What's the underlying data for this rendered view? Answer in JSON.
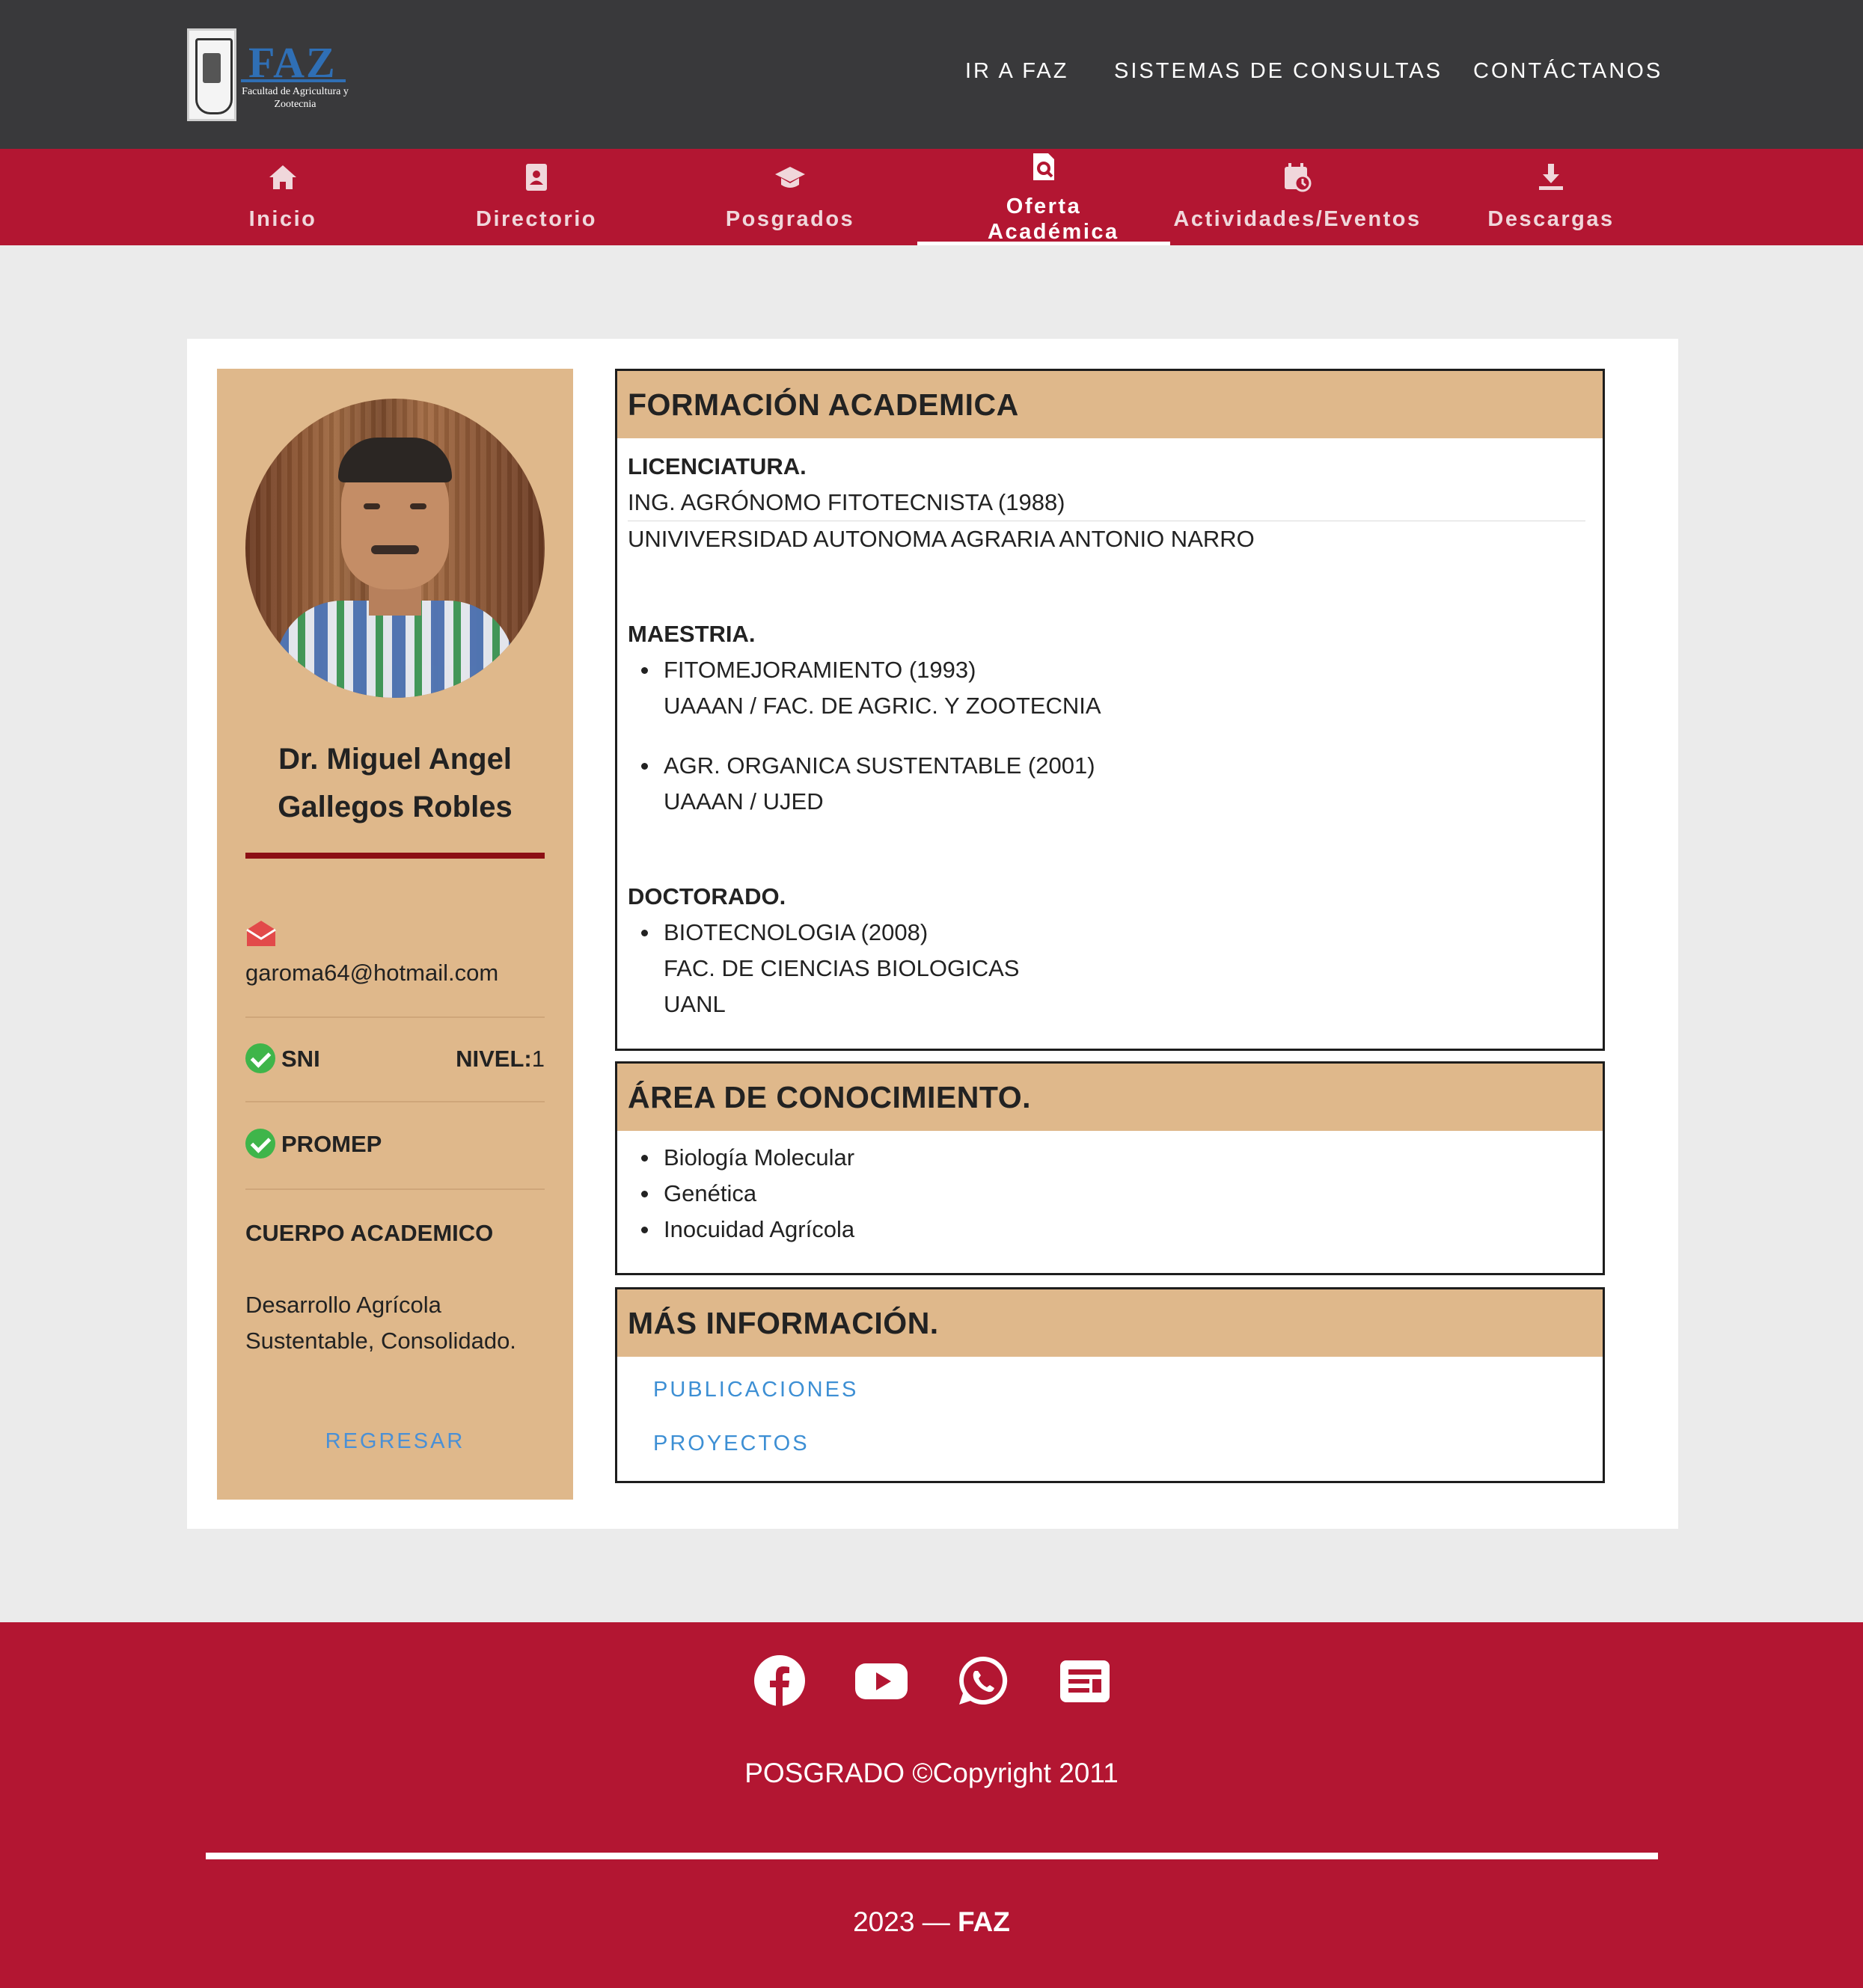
{
  "brand": {
    "logo_text": "FAZ",
    "logo_subtitle": "Facultad de Agricultura y Zootecnia"
  },
  "topnav": [
    {
      "label": "IR A FAZ"
    },
    {
      "label": "SISTEMAS DE CONSULTAS"
    },
    {
      "label": "CONTÁCTANOS"
    }
  ],
  "mainnav": [
    {
      "label": "Inicio",
      "icon": "home-icon"
    },
    {
      "label": "Directorio",
      "icon": "contact-book-icon"
    },
    {
      "label": "Posgrados",
      "icon": "graduation-cap-icon"
    },
    {
      "label": "Oferta Académica",
      "icon": "search-document-icon",
      "active": true
    },
    {
      "label": "Actividades/Eventos",
      "icon": "calendar-clock-icon"
    },
    {
      "label": "Descargas",
      "icon": "download-icon"
    }
  ],
  "profile": {
    "name": "Dr. Miguel Angel Gallegos Robles",
    "email": "garoma64@hotmail.com",
    "snni_label": "SNI",
    "nivel_label": "NIVEL:",
    "nivel_value": "1",
    "promep_label": "PROMEP",
    "cuerpo_title": "CUERPO ACADEMICO",
    "cuerpo_text": "Desarrollo Agrícola Sustentable, Consolidado.",
    "back_label": "REGRESAR"
  },
  "formacion": {
    "title": "FORMACIÓN ACADEMICA",
    "licenciatura": {
      "label": "LICENCIATURA.",
      "degree": "ING. AGRÓNOMO FITOTECNISTA (1988)",
      "school": "UNIVIVERSIDAD AUTONOMA AGRARIA ANTONIO NARRO"
    },
    "maestria": {
      "label": "MAESTRIA.",
      "items": [
        {
          "degree": "FITOMEJORAMIENTO (1993)",
          "school": "UAAAN / FAC. DE AGRIC. Y ZOOTECNIA"
        },
        {
          "degree": "AGR. ORGANICA SUSTENTABLE (2001)",
          "school": "UAAAN / UJED"
        }
      ]
    },
    "doctorado": {
      "label": "DOCTORADO.",
      "degree": "BIOTECNOLOGIA (2008)",
      "school1": "FAC. DE CIENCIAS BIOLOGICAS",
      "school2": "UANL"
    }
  },
  "area": {
    "title": "ÁREA DE CONOCIMIENTO.",
    "items": [
      "Biología Molecular",
      "Genética",
      "Inocuidad Agrícola"
    ]
  },
  "mas": {
    "title": "MÁS INFORMACIÓN.",
    "links": [
      "PUBLICACIONES",
      "PROYECTOS"
    ]
  },
  "footer": {
    "social": [
      "facebook-icon",
      "youtube-icon",
      "whatsapp-icon",
      "news-icon"
    ],
    "copyright": "POSGRADO ©Copyright 2011",
    "year_prefix": "2023 — ",
    "year_brand": "FAZ"
  },
  "colors": {
    "header": "#39393b",
    "brand_red": "#b31632",
    "tan": "#dfb88b",
    "link_blue": "#4a90d6",
    "check_green": "#3fb54a"
  }
}
